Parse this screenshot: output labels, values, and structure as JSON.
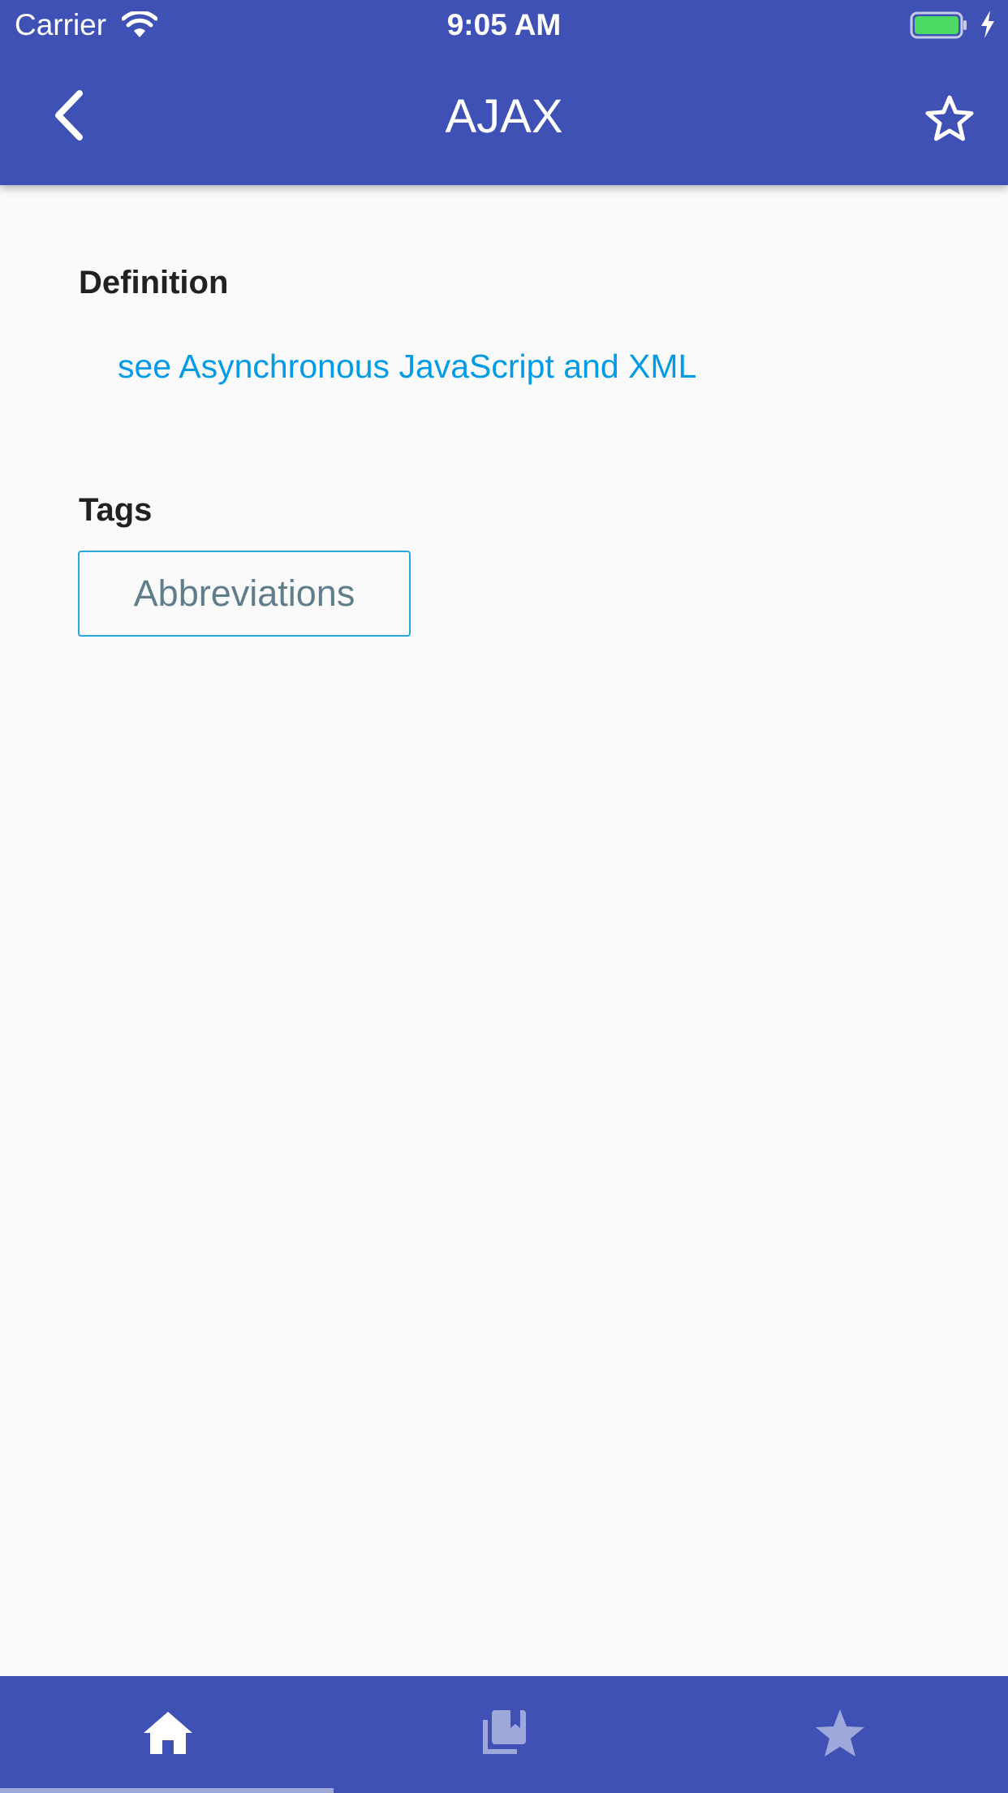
{
  "status_bar": {
    "carrier": "Carrier",
    "time": "9:05 AM",
    "battery_color": "#4cd964",
    "icons": [
      "wifi-icon",
      "battery-icon",
      "charging-bolt-icon"
    ]
  },
  "app_bar": {
    "title": "AJAX",
    "background": "#3f51b5",
    "left_icon": "chevron-left-icon",
    "right_icon": "star-outline-icon"
  },
  "definition": {
    "heading": "Definition",
    "link_text": "see Asynchronous JavaScript and XML",
    "link_color": "#039be5"
  },
  "tags": {
    "heading": "Tags",
    "items": [
      "Abbreviations"
    ],
    "chip_border_color": "#29a8e0",
    "chip_text_color": "#607d8b"
  },
  "bottom_nav": {
    "background": "#3f51b5",
    "selected_index": 0,
    "items": [
      {
        "icon": "home-icon",
        "active": true
      },
      {
        "icon": "library-books-icon",
        "active": false
      },
      {
        "icon": "star-icon",
        "active": false
      }
    ]
  }
}
